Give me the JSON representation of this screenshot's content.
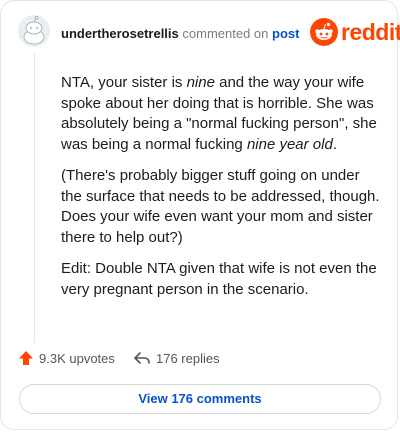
{
  "header": {
    "username": "undertherosetrellis",
    "action_text": "commented on",
    "post_link": "post",
    "brand": "reddit"
  },
  "comment": {
    "p1_a": "NTA, your sister is ",
    "p1_em1": "nine",
    "p1_b": " and the way your wife spoke about her doing that is horrible. She was absolutely being a \"normal fucking person\", she was being a normal fucking ",
    "p1_em2": "nine year old",
    "p1_c": ".",
    "p2": "(There's probably bigger stuff going on under the surface that needs to be addressed, though. Does your wife even want your mom and sister there to help out?)",
    "p3": "Edit: Double NTA given that wife is not even the very pregnant person in the scenario."
  },
  "stats": {
    "upvotes": "9.3K upvotes",
    "replies": "176 replies"
  },
  "footer": {
    "view_comments": "View 176 comments"
  },
  "colors": {
    "brand": "#ff4500",
    "link": "#0a52c7"
  }
}
